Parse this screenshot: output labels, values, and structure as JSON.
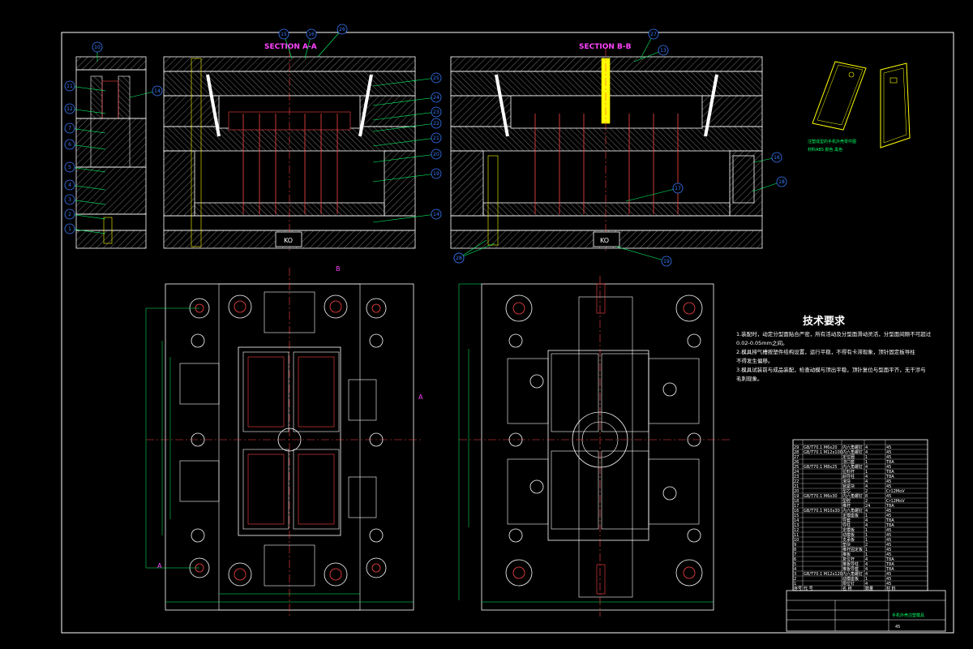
{
  "section_a_title": "SECTION A-A",
  "section_b_title": "SECTION B-B",
  "ko_label_left": "KO",
  "ko_label_right": "KO",
  "view_marker_b": "B",
  "view_marker_a_right": "A",
  "view_marker_a_left": "A",
  "requirements": {
    "title": "技术要求",
    "lines": [
      "1.装配时，动定分型面贴合严密，所有活动及分型面滑动灵活，分型面间隙不可超过",
      "0.02-0.05mm之间。",
      "2.模具排气槽按塑件结构设置，运行平稳，不得有卡滞现象，顶针固定板导柱",
      "不得发生偏移。",
      "3.模具试装前与成品装配，检查动模与顶出平稳，顶针复位与型面平齐，无干涉与",
      "毛刺现象。"
    ]
  },
  "product_caption": [
    "注塑成型的手机外壳零件图",
    "材料ABS 颜色:黑色"
  ],
  "callouts_left": [
    "10",
    "11",
    "12",
    "7",
    "6",
    "5",
    "4",
    "3",
    "2",
    "1"
  ],
  "callouts_a_top": [
    "15",
    "16",
    "26"
  ],
  "callouts_a_right": [
    "25",
    "24",
    "23",
    "22",
    "21",
    "20",
    "19",
    "14"
  ],
  "callouts_b_top": [
    "27",
    "13"
  ],
  "callouts_b_right": [
    "16",
    "18",
    "17",
    "19",
    "29"
  ],
  "callouts_b_bottom": [
    "28"
  ],
  "title_block": {
    "drawing_name": "手机外壳注塑模具",
    "material_row": "45"
  },
  "bom_rows": [
    [
      "29",
      "GB/T70.1 M6x20",
      "内六角螺钉",
      "4",
      "45"
    ],
    [
      "28",
      "GB/T70.1 M12x100",
      "内六角螺钉",
      "4",
      "45"
    ],
    [
      "27",
      "",
      "定位圈",
      "1",
      "45"
    ],
    [
      "26",
      "",
      "浇口套",
      "1",
      "T8A"
    ],
    [
      "25",
      "GB/T70.1 M8x25",
      "内六角螺钉",
      "4",
      "45"
    ],
    [
      "24",
      "",
      "拉料杆",
      "1",
      "T8A"
    ],
    [
      "23",
      "",
      "斜导柱",
      "4",
      "T8A"
    ],
    [
      "22",
      "",
      "滑块",
      "4",
      "45"
    ],
    [
      "21",
      "",
      "锁紧块",
      "4",
      "45"
    ],
    [
      "20",
      "",
      "型芯",
      "2",
      "Cr12MoV"
    ],
    [
      "19",
      "GB/T70.1 M6x30",
      "内六角螺钉",
      "8",
      "45"
    ],
    [
      "18",
      "",
      "型腔",
      "2",
      "Cr12MoV"
    ],
    [
      "17",
      "",
      "推杆",
      "24",
      "T8A"
    ],
    [
      "16",
      "GB/T70.1 M10x30",
      "内六角螺钉",
      "4",
      "45"
    ],
    [
      "15",
      "",
      "定模座板",
      "1",
      "45"
    ],
    [
      "14",
      "",
      "导套",
      "4",
      "T8A"
    ],
    [
      "13",
      "",
      "导柱",
      "4",
      "T8A"
    ],
    [
      "12",
      "",
      "定模板",
      "1",
      "45"
    ],
    [
      "11",
      "",
      "动模板",
      "1",
      "45"
    ],
    [
      "10",
      "",
      "支承板",
      "1",
      "45"
    ],
    [
      "9",
      "",
      "垫块",
      "2",
      "45"
    ],
    [
      "8",
      "",
      "推杆固定板",
      "1",
      "45"
    ],
    [
      "7",
      "",
      "推板",
      "1",
      "45"
    ],
    [
      "6",
      "",
      "复位杆",
      "4",
      "T8A"
    ],
    [
      "5",
      "",
      "推板导柱",
      "4",
      "T8A"
    ],
    [
      "4",
      "",
      "推板导套",
      "4",
      "T8A"
    ],
    [
      "3",
      "GB/T70.1 M12x120",
      "内六角螺钉",
      "4",
      "45"
    ],
    [
      "2",
      "",
      "动模座板",
      "1",
      "45"
    ],
    [
      "1",
      "",
      "限位钉",
      "4",
      "45"
    ]
  ],
  "bom_header": [
    "序号",
    "代 号",
    "名 称",
    "数量",
    "材 料"
  ]
}
